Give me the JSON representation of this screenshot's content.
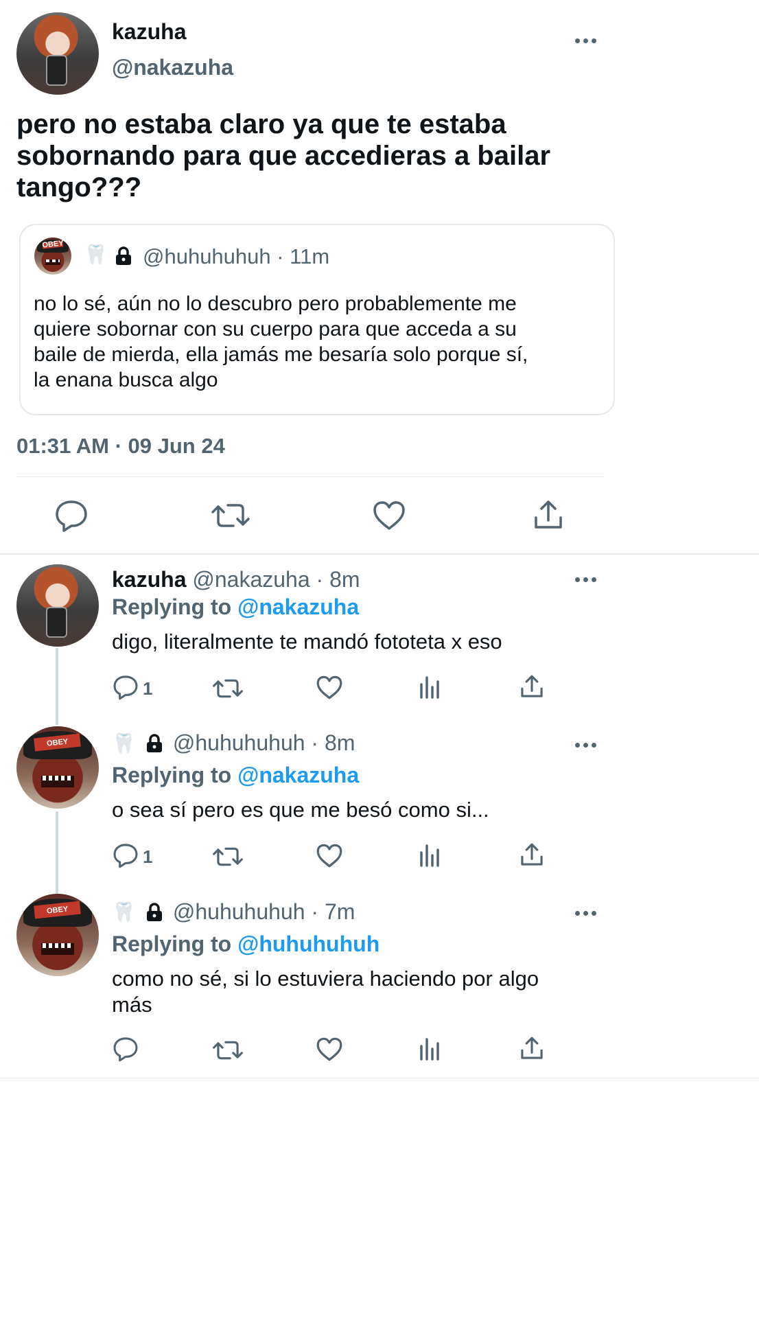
{
  "main_tweet": {
    "display_name": "kazuha",
    "handle": "@nakazuha",
    "text": "pero no estaba claro ya que te estaba sobornando para que accedieras a bailar tango???",
    "text_lines": [
      "pero no estaba claro ya que te estaba",
      "sobornando para que accedieras a bailar",
      "tango???"
    ],
    "timestamp": "01:31 AM · 09 Jun 24",
    "quoted": {
      "emoji": "🦷",
      "handle_time": "@huhuhuhuh · 11m",
      "text_lines": [
        "no lo sé, aún no lo descubro pero probablemente me",
        "quiere sobornar con su cuerpo para que acceda a su",
        "baile de mierda, ella jamás me besaría solo porque sí,",
        "la enana busca algo"
      ]
    },
    "actions": [
      "reply-icon",
      "retweet-icon",
      "like-icon",
      "share-icon"
    ]
  },
  "replies": [
    {
      "display_name": "kazuha",
      "handle_time": "@nakazuha · 8m",
      "replying_prefix": "Replying to",
      "replying_to": "@nakazuha",
      "text_lines": [
        "digo, literalmente te mandó fototeta x eso"
      ],
      "reply_count": "1"
    },
    {
      "emoji": "🦷",
      "handle_time": "@huhuhuhuh · 8m",
      "replying_prefix": "Replying to",
      "replying_to": "@nakazuha",
      "text_lines": [
        "o sea sí pero es que me besó como si..."
      ],
      "reply_count": "1"
    },
    {
      "emoji": "🦷",
      "handle_time": "@huhuhuhuh · 7m",
      "replying_prefix": "Replying to",
      "replying_to": "@huhuhuhuh",
      "text_lines": [
        "como no sé, si lo estuviera haciendo por algo",
        "más"
      ],
      "reply_count": ""
    }
  ],
  "avatar_cap_text": "OBEY",
  "colors": {
    "link": "#1d9bf0",
    "muted": "#536471",
    "text": "#0f1419",
    "divider": "#e6e9ec"
  }
}
